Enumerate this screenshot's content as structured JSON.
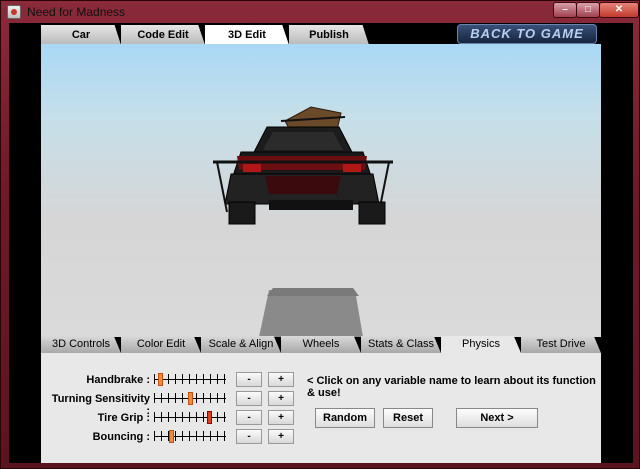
{
  "window": {
    "title": "Need for Madness"
  },
  "top_tabs": [
    {
      "label": "Car",
      "active": false
    },
    {
      "label": "Code Edit",
      "active": false
    },
    {
      "label": "3D Edit",
      "active": true
    },
    {
      "label": "Publish",
      "active": false
    }
  ],
  "back_button": "BACK TO GAME",
  "bottom_tabs": [
    {
      "label": "3D Controls",
      "active": false
    },
    {
      "label": "Color Edit",
      "active": false
    },
    {
      "label": "Scale & Align",
      "active": false
    },
    {
      "label": "Wheels",
      "active": false
    },
    {
      "label": "Stats & Class",
      "active": false
    },
    {
      "label": "Physics",
      "active": true
    },
    {
      "label": "Test Drive",
      "active": false
    }
  ],
  "physics": {
    "variables": [
      {
        "label": "Handbrake :",
        "value": 0.06
      },
      {
        "label": "Turning Sensitivity :",
        "value": 0.5
      },
      {
        "label": "Tire Grip :",
        "value": 0.78
      },
      {
        "label": "Bouncing :",
        "value": 0.22
      }
    ],
    "minus_label": "-",
    "plus_label": "+",
    "hint": "< Click on any variable name to learn about its function & use!",
    "random_label": "Random",
    "reset_label": "Reset",
    "next_label": "Next  >"
  },
  "colors": {
    "slider_knob": "#f08a3c",
    "knob_red": "#e04020",
    "car_body": "#1c1c1c",
    "car_red": "#6a0e12"
  }
}
